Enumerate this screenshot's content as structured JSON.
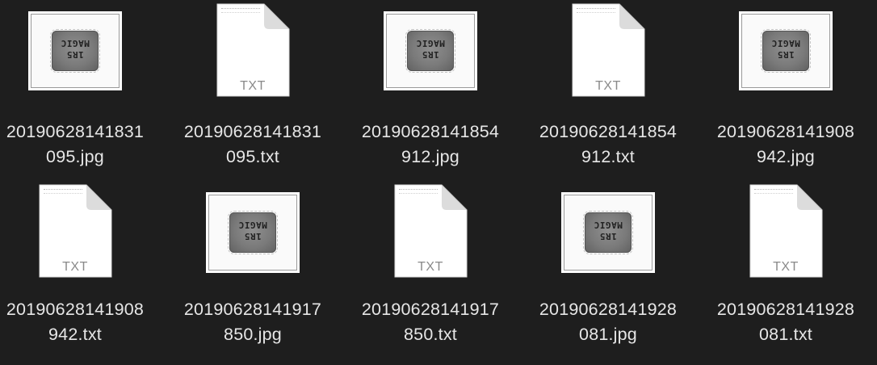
{
  "files": [
    {
      "kind": "image",
      "name_line1": "20190628141831",
      "name_line2": "095.jpg",
      "chip_line1": "1R5",
      "chip_line2": "MAGIC",
      "icon": "image-thumbnail-icon"
    },
    {
      "kind": "text",
      "name_line1": "20190628141831",
      "name_line2": "095.txt",
      "type_label": "TXT",
      "icon": "text-document-icon"
    },
    {
      "kind": "image",
      "name_line1": "20190628141854",
      "name_line2": "912.jpg",
      "chip_line1": "1R5",
      "chip_line2": "MAGIC",
      "icon": "image-thumbnail-icon"
    },
    {
      "kind": "text",
      "name_line1": "20190628141854",
      "name_line2": "912.txt",
      "type_label": "TXT",
      "icon": "text-document-icon"
    },
    {
      "kind": "image",
      "name_line1": "20190628141908",
      "name_line2": "942.jpg",
      "chip_line1": "1R5",
      "chip_line2": "MAGIC",
      "icon": "image-thumbnail-icon"
    },
    {
      "kind": "text",
      "name_line1": "20190628141908",
      "name_line2": "942.txt",
      "type_label": "TXT",
      "icon": "text-document-icon"
    },
    {
      "kind": "image",
      "name_line1": "20190628141917",
      "name_line2": "850.jpg",
      "chip_line1": "1R5",
      "chip_line2": "MAGIC",
      "icon": "image-thumbnail-icon"
    },
    {
      "kind": "text",
      "name_line1": "20190628141917",
      "name_line2": "850.txt",
      "type_label": "TXT",
      "icon": "text-document-icon"
    },
    {
      "kind": "image",
      "name_line1": "20190628141928",
      "name_line2": "081.jpg",
      "chip_line1": "1R5",
      "chip_line2": "MAGIC",
      "icon": "image-thumbnail-icon"
    },
    {
      "kind": "text",
      "name_line1": "20190628141928",
      "name_line2": "081.txt",
      "type_label": "TXT",
      "icon": "text-document-icon"
    }
  ],
  "colors": {
    "background": "#1e1e1e",
    "filename_text": "#e6e6e6",
    "doc_label": "#8a8a8a"
  }
}
